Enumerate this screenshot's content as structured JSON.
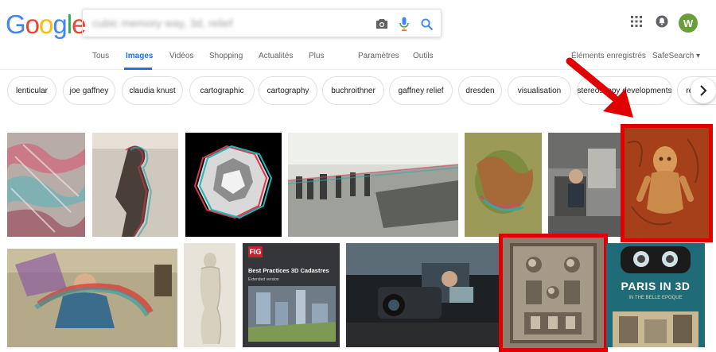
{
  "logo": {
    "letters": [
      "G",
      "o",
      "o",
      "g",
      "l",
      "e"
    ],
    "colors": [
      "#4285f4",
      "#ea4335",
      "#fbbc05",
      "#4285f4",
      "#34a853",
      "#ea4335"
    ]
  },
  "search": {
    "query": "cubic memory way, 3d, relief"
  },
  "header": {
    "avatar_letter": "W",
    "avatar_color": "#689f38"
  },
  "tabs": [
    {
      "label": "Tous"
    },
    {
      "label": "Images"
    },
    {
      "label": "Vidéos"
    },
    {
      "label": "Shopping"
    },
    {
      "label": "Actualités"
    },
    {
      "label": "Plus"
    },
    {
      "label": "Paramètres"
    },
    {
      "label": "Outils"
    },
    {
      "label": "Éléments enregistrés"
    },
    {
      "label": "SafeSearch ▾"
    }
  ],
  "chips": [
    "lenticular",
    "joe gaffney",
    "claudia knust",
    "cartographic",
    "cartography",
    "buchroithner",
    "gaffney relief",
    "dresden",
    "visualisation",
    "stereoscopy developments",
    "relief printing"
  ],
  "thumbnails": [
    {
      "id": "anaglyph-terrain",
      "caption": ""
    },
    {
      "id": "anaglyph-statue",
      "caption": ""
    },
    {
      "id": "polyhedron-anaglyph",
      "caption": ""
    },
    {
      "id": "soldiers-street",
      "caption": ""
    },
    {
      "id": "green-sculpture",
      "caption": ""
    },
    {
      "id": "office-anaglyph",
      "caption": ""
    },
    {
      "id": "orange-figure",
      "caption": ""
    },
    {
      "id": "person-anaglyph",
      "caption": ""
    },
    {
      "id": "white-relief-figure",
      "caption": ""
    },
    {
      "id": "fig-book",
      "caption": "FIG",
      "title": "Best Practices 3D Cadastres",
      "subtitle": "Extended version"
    },
    {
      "id": "camera-operator",
      "caption": ""
    },
    {
      "id": "carved-panel",
      "caption": ""
    },
    {
      "id": "paris-book",
      "caption": "PARIS IN 3D",
      "subtitle": "IN THE BELLE EPOQUE"
    }
  ],
  "highlight_color": "#e00000"
}
